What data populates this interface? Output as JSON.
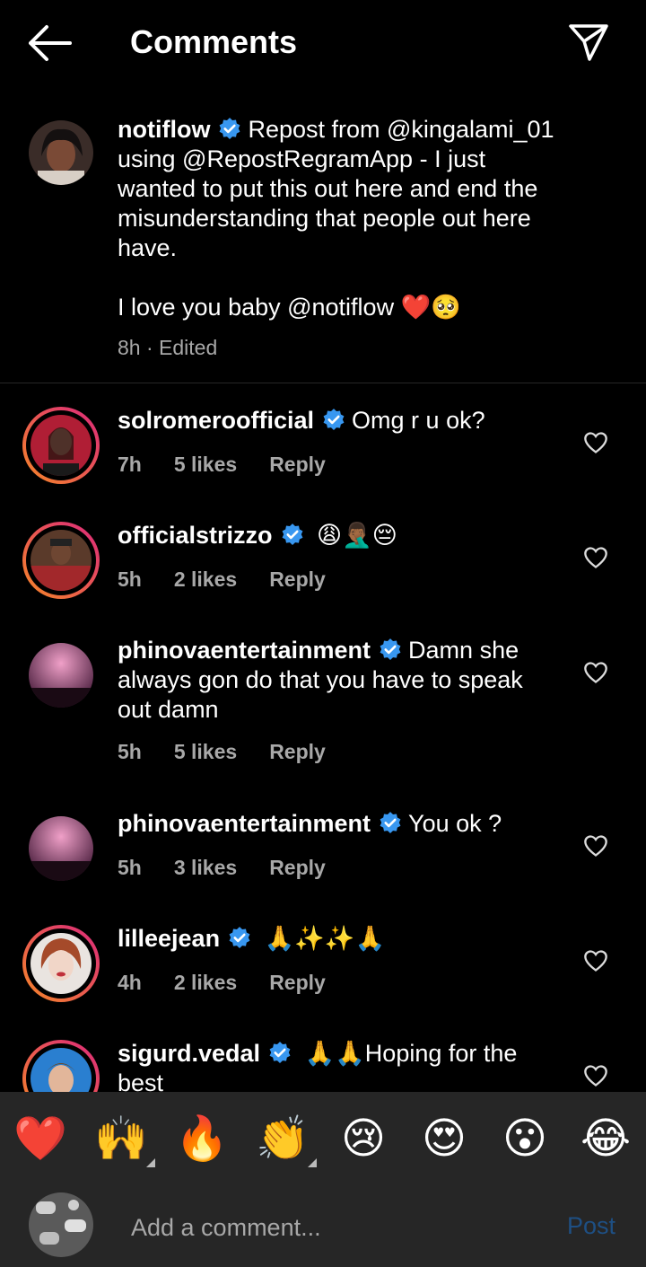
{
  "header": {
    "title": "Comments"
  },
  "caption": {
    "username": "notiflow",
    "text_lines": [
      "Repost from @kingalami_01",
      "using @RepostRegramApp - I just",
      "wanted to put this out here and end the",
      "misunderstanding that people out here",
      "have."
    ],
    "second_paragraph": "I love you baby @notiflow ❤️🥺",
    "meta": "8h · Edited"
  },
  "comments": [
    {
      "username": "solromeroofficial",
      "text": "Omg r u ok?",
      "time": "7h",
      "likes": "5 likes",
      "reply": "Reply"
    },
    {
      "username": "officialstrizzo",
      "text": "😩🤦🏾‍♂️😔",
      "time": "5h",
      "likes": "2 likes",
      "reply": "Reply"
    },
    {
      "username": "phinovaentertainment",
      "text_first": "Damn she",
      "text_rest": "always gon do that you have to speak out damn",
      "time": "5h",
      "likes": "5 likes",
      "reply": "Reply"
    },
    {
      "username": "phinovaentertainment",
      "text": "You ok ?",
      "time": "5h",
      "likes": "3 likes",
      "reply": "Reply"
    },
    {
      "username": "lilleejean",
      "text": "🙏✨✨🙏",
      "time": "4h",
      "likes": "2 likes",
      "reply": "Reply"
    },
    {
      "username": "sigurd.vedal",
      "text": "🙏🙏Hoping for the best"
    }
  ],
  "reactions": [
    "❤️",
    "🙌",
    "🔥",
    "👏",
    "😢",
    "😍",
    "😮",
    "😂"
  ],
  "compose": {
    "placeholder": "Add a comment...",
    "post_label": "Post"
  },
  "colors": {
    "verified": "#3897f0",
    "ring_start": "#f58529",
    "ring_end": "#dd2a7b",
    "post_disabled": "#1e4f83"
  }
}
